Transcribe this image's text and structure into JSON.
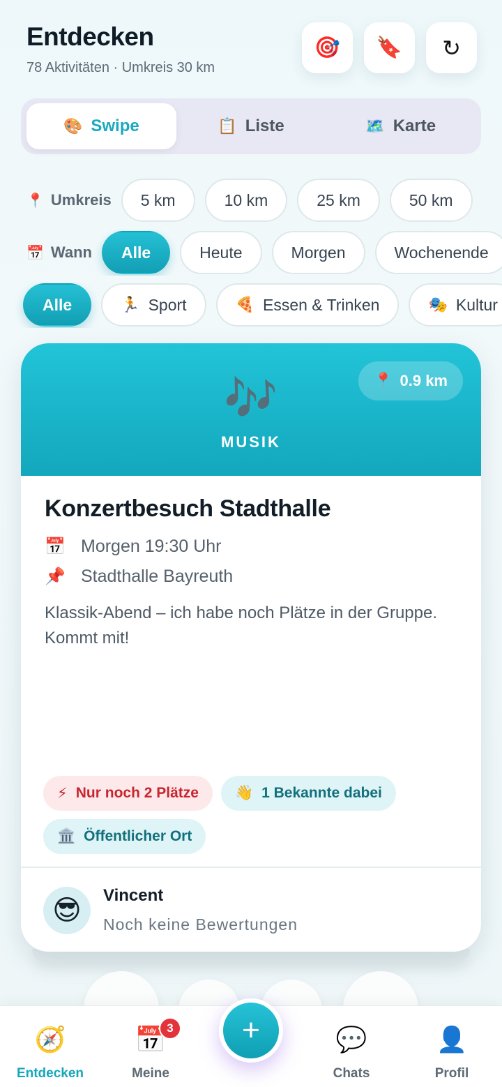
{
  "header": {
    "title": "Entdecken",
    "subtitle": "78 Aktivitäten · Umkreis 30 km",
    "buttons": [
      {
        "name": "target-icon",
        "glyph": "🎯"
      },
      {
        "name": "bookmark-icon",
        "glyph": "🔖"
      },
      {
        "name": "refresh-icon",
        "glyph": "↻"
      }
    ]
  },
  "view_tabs": [
    {
      "label": "Swipe",
      "icon": "🎨",
      "active": true
    },
    {
      "label": "Liste",
      "icon": "📋",
      "active": false
    },
    {
      "label": "Karte",
      "icon": "🗺️",
      "active": false
    }
  ],
  "radius": {
    "label": "Umkreis",
    "icon": "📍",
    "options": [
      "5 km",
      "10 km",
      "25 km",
      "50 km"
    ]
  },
  "when": {
    "label": "Wann",
    "icon": "📅",
    "options": [
      "Alle",
      "Heute",
      "Morgen",
      "Wochenende"
    ],
    "selected": "Alle"
  },
  "categories": {
    "options": [
      {
        "label": "Alle",
        "icon": ""
      },
      {
        "label": "Sport",
        "icon": "🏃"
      },
      {
        "label": "Essen & Trinken",
        "icon": "🍕"
      },
      {
        "label": "Kultur",
        "icon": "🎭"
      }
    ],
    "selected": "Alle"
  },
  "card": {
    "category": "MUSIK",
    "category_icon": "🎶",
    "distance": "0.9 km",
    "distance_icon": "📍",
    "title": "Konzertbesuch Stadthalle",
    "datetime": "Morgen 19:30 Uhr",
    "datetime_icon": "📅",
    "location": "Stadthalle Bayreuth",
    "location_icon": "📌",
    "description": "Klassik-Abend – ich habe noch Plätze in der Gruppe. Kommt mit!",
    "tags": [
      {
        "label": "Nur noch 2 Plätze",
        "icon": "⚡",
        "style": "red"
      },
      {
        "label": "1 Bekannte dabei",
        "icon": "👋",
        "style": "teal"
      },
      {
        "label": "Öffentlicher Ort",
        "icon": "🏛️",
        "style": "teal"
      }
    ],
    "host": {
      "name": "Vincent",
      "avatar": "😎",
      "rating": "Noch keine Bewertungen"
    }
  },
  "nav": {
    "items": [
      {
        "label": "Entdecken",
        "icon": "🧭",
        "active": true
      },
      {
        "label": "Meine",
        "icon": "📅",
        "badge": "3"
      },
      {
        "label": "Chats",
        "icon": "💬"
      },
      {
        "label": "Profil",
        "icon": "👤"
      }
    ],
    "fab": "+"
  }
}
